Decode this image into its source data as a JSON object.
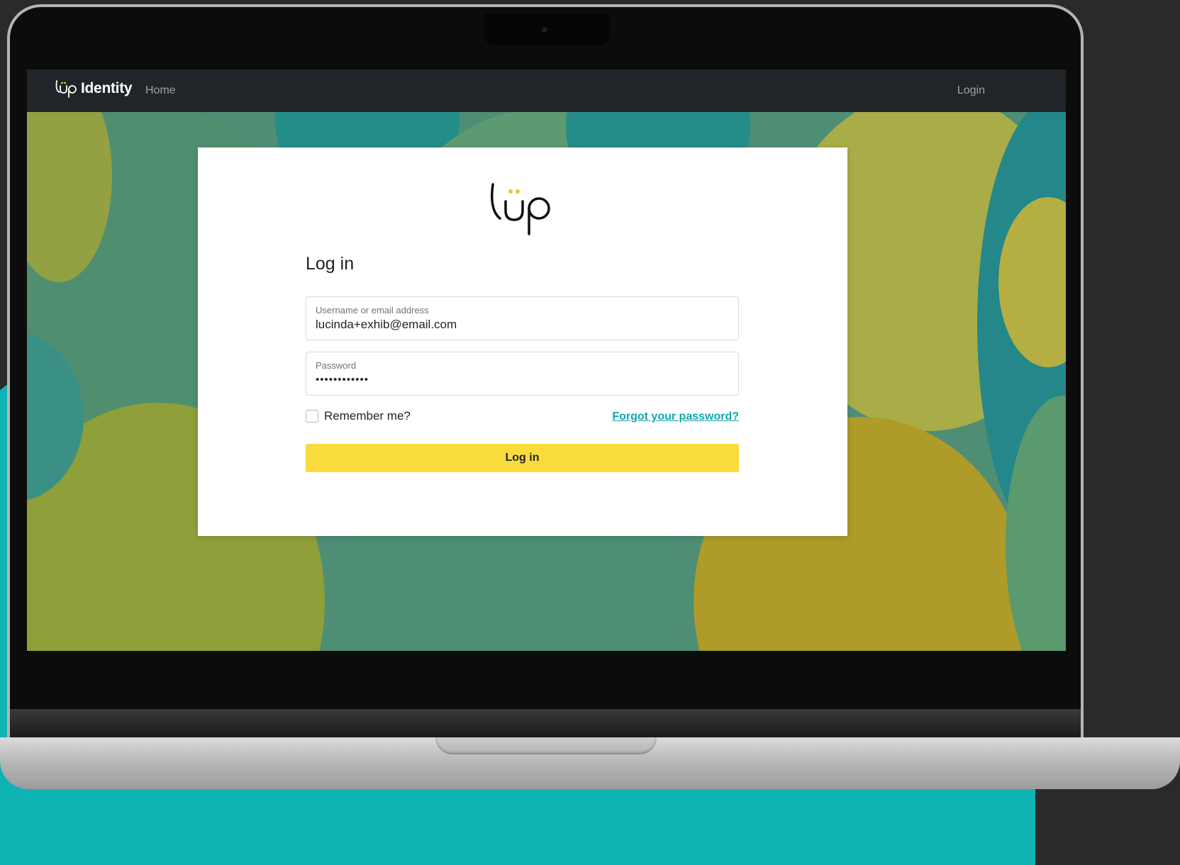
{
  "navbar": {
    "brand_title": "Identity",
    "home_label": "Home",
    "login_label": "Login"
  },
  "card": {
    "logo_icon": "lup-logo-icon",
    "heading": "Log in",
    "username": {
      "label": "Username or email address",
      "value": "lucinda+exhib@email.com"
    },
    "password": {
      "label": "Password",
      "value": "••••••••••••"
    },
    "remember_label": "Remember me?",
    "remember_checked": false,
    "forgot_label": "Forgot your password?",
    "submit_label": "Log in"
  },
  "colors": {
    "navbar_bg": "#212529",
    "button_bg": "#fadb3c",
    "link": "#10a6b0",
    "logo_dots": "#f2c416",
    "accent_teal": "#10b3b3"
  }
}
